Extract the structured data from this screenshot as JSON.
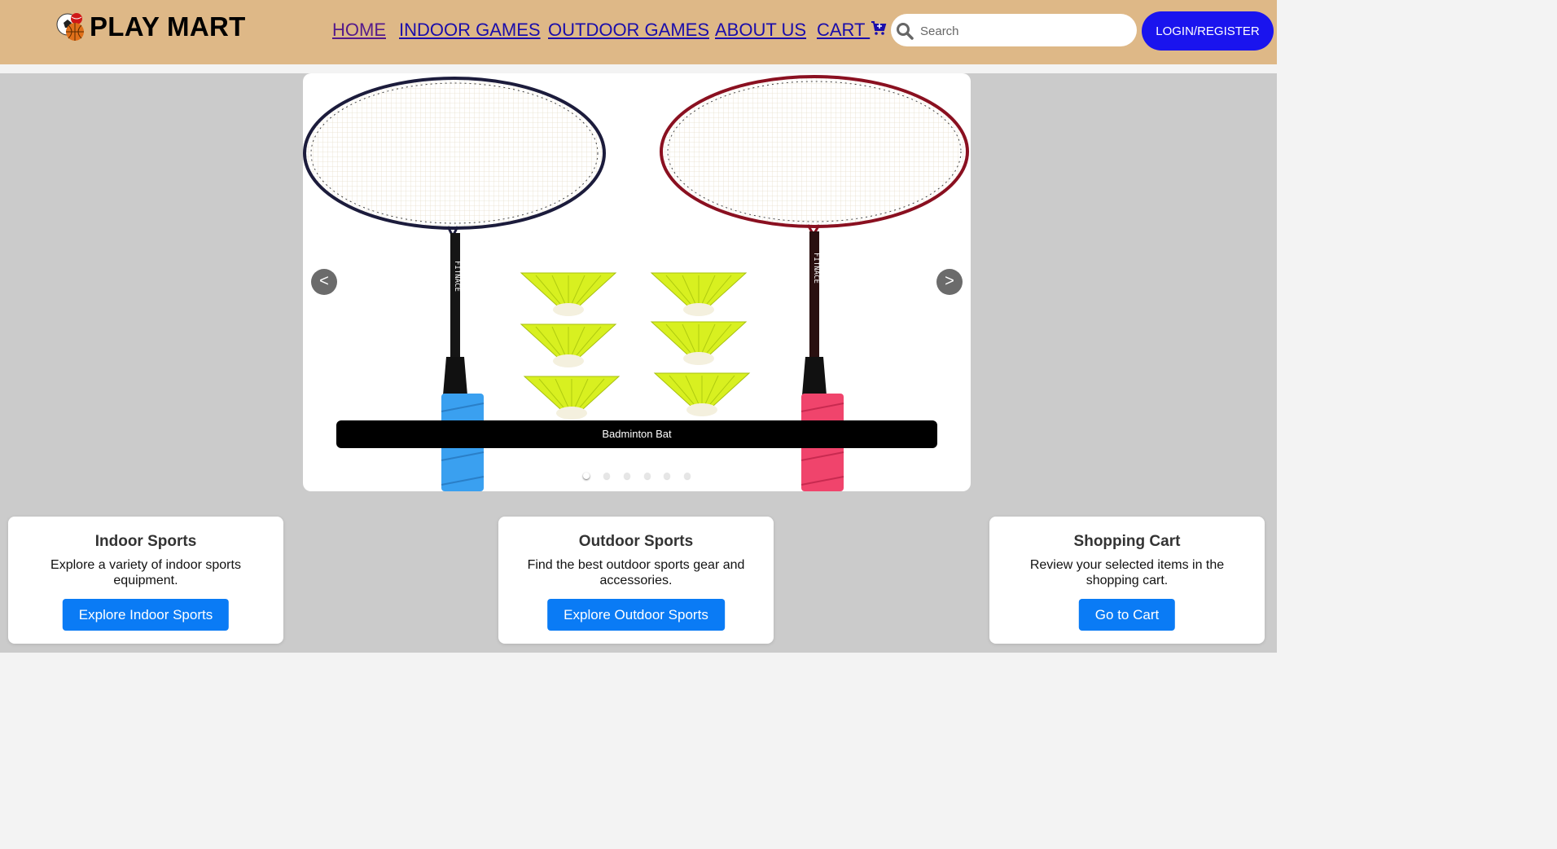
{
  "header": {
    "brand": "PLAY MART",
    "nav": [
      {
        "label": "HOME"
      },
      {
        "label": "INDOOR GAMES"
      },
      {
        "label": "OUTDOOR GAMES"
      },
      {
        "label": "ABOUT US"
      },
      {
        "label": "CART "
      }
    ],
    "search_placeholder": "Search",
    "login_label": "LOGIN/REGISTER"
  },
  "carousel": {
    "prev_label": "<",
    "next_label": ">",
    "caption": "Badminton Bat",
    "image_text": "FITNACE",
    "dot_count": 6,
    "active_dot": 0
  },
  "cards": [
    {
      "title": "Indoor Sports",
      "text": "Explore a variety of indoor sports equipment.",
      "button": "Explore Indoor Sports"
    },
    {
      "title": "Outdoor Sports",
      "text": "Find the best outdoor sports gear and accessories.",
      "button": "Explore Outdoor Sports"
    },
    {
      "title": "Shopping Cart",
      "text": "Review your selected items in the shopping cart.",
      "button": "Go to Cart"
    }
  ],
  "colors": {
    "header_bg": "#deb887",
    "login_bg": "#1a14ee",
    "card_button_bg": "#0a7bf5",
    "page_bg": "#cbcbcb"
  },
  "icons": {
    "logo": "sports-balls-icon",
    "cart": "shopping-cart-icon",
    "search": "search-icon"
  }
}
